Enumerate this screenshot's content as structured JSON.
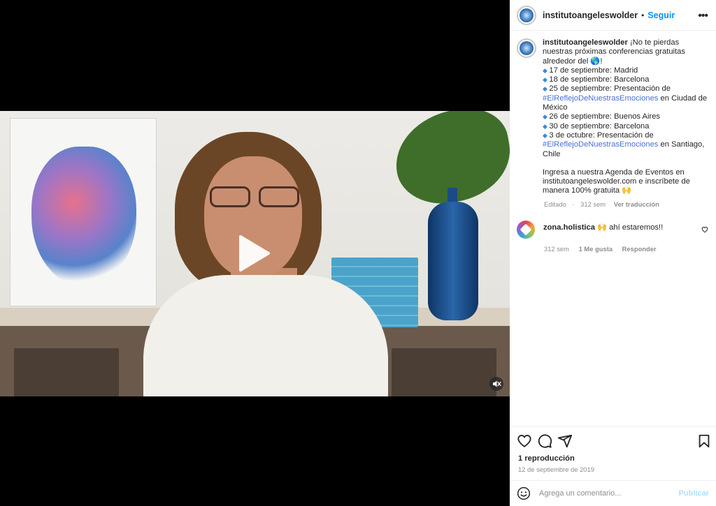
{
  "header": {
    "username": "institutoangeleswolder",
    "dot": "•",
    "follow_label": "Seguir",
    "more_label": "•••"
  },
  "caption": {
    "username": "institutoangeleswolder",
    "intro": "¡No te pierdas nuestras próximas conferencias gratuitas alrededor del 🌎!",
    "events": [
      {
        "pre": "17 de septiembre: Madrid",
        "hashtag": "",
        "post": ""
      },
      {
        "pre": "18 de septiembre: Barcelona",
        "hashtag": "",
        "post": ""
      },
      {
        "pre": "25 de septiembre: Presentación de ",
        "hashtag": "#ElReflejoDeNuestrasEmociones",
        "post": " en Ciudad de México"
      },
      {
        "pre": "26 de septiembre: Buenos Aires",
        "hashtag": "",
        "post": ""
      },
      {
        "pre": "30 de septiembre: Barcelona",
        "hashtag": "",
        "post": ""
      },
      {
        "pre": "3 de octubre: Presentación de ",
        "hashtag": "#ElReflejoDeNuestrasEmociones",
        "post": " en Santiago, Chile"
      }
    ],
    "outro": "Ingresa a nuestra Agenda de Eventos en institutoangeleswolder.com e inscríbete de manera 100% gratuita 🙌",
    "edited": "Editado",
    "time": "312 sem",
    "translate_label": "Ver traducción"
  },
  "comments": [
    {
      "username": "zona.holistica",
      "text": "🙌 ahí estaremos!!",
      "time": "312 sem",
      "likes": "1 Me gusta",
      "reply_label": "Responder"
    }
  ],
  "stats": {
    "views": "1 reproducción",
    "date": "12 de septiembre de 2019"
  },
  "add_comment": {
    "placeholder": "Agrega un comentario...",
    "publish_label": "Publicar"
  },
  "icons": [
    "like-icon",
    "comment-icon",
    "share-icon",
    "save-icon",
    "emoji-icon",
    "play-icon",
    "mute-icon",
    "heart-small-icon"
  ],
  "colors": {
    "accent": "#0095f6",
    "hashtag": "#4a6fd6",
    "muted": "#8e8e8e",
    "publish_disabled": "#b2dffc"
  }
}
